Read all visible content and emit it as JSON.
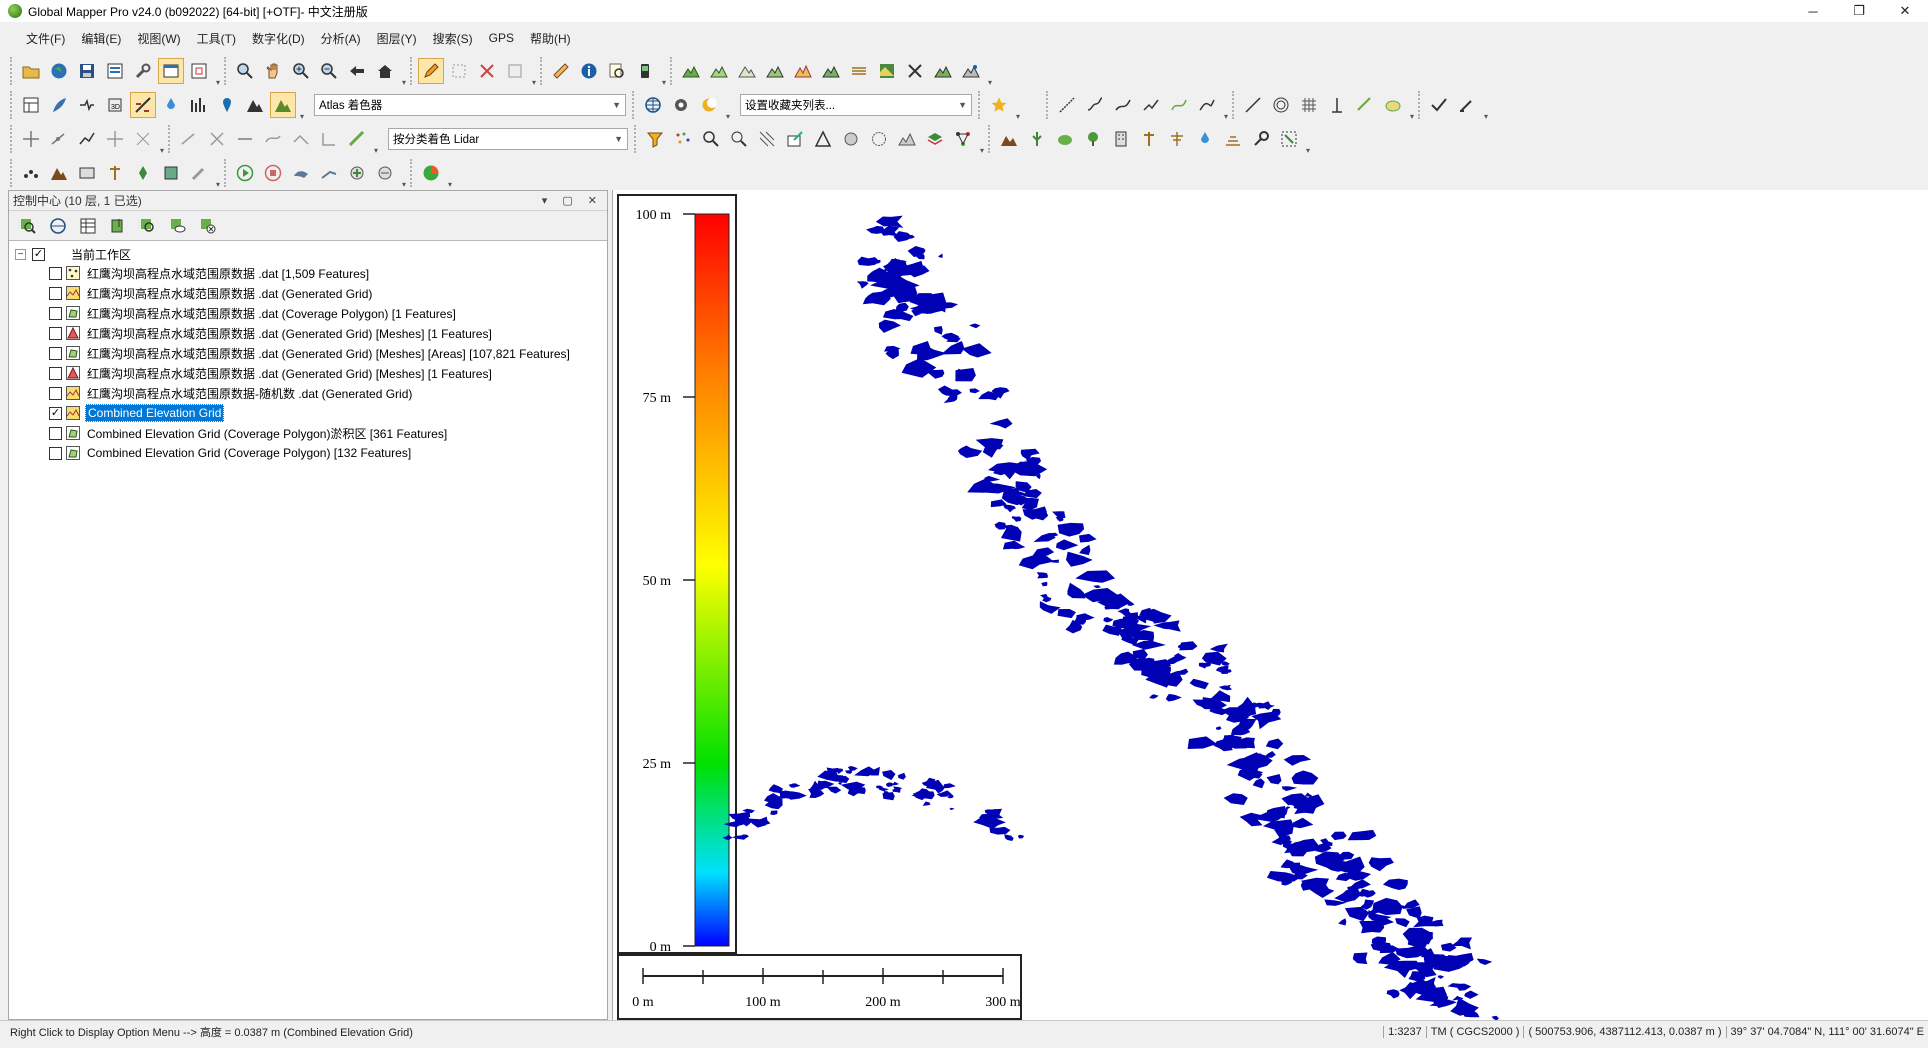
{
  "window": {
    "title": "Global Mapper Pro v24.0 (b092022) [64-bit] [+OTF]- 中文注册版",
    "minimize_glyph": "─",
    "restore_glyph": "❐",
    "close_glyph": "✕"
  },
  "menu": {
    "items": [
      "文件(F)",
      "编辑(E)",
      "视图(W)",
      "工具(T)",
      "数字化(D)",
      "分析(A)",
      "图层(Y)",
      "搜索(S)",
      "GPS",
      "帮助(H)"
    ]
  },
  "toolbar": {
    "shader_combo": "Atlas 着色器",
    "favorites_combo": "设置收藏夹列表...",
    "lidar_combo": "按分类着色 Lidar"
  },
  "control_center": {
    "title": "控制中心 (10 层, 1 已选)",
    "root_label": "当前工作区",
    "root_checked": true,
    "layers": [
      {
        "label": "红鹰沟坝高程点水域范围原数据 .dat [1,509 Features]",
        "icon": "points-icon",
        "checked": false,
        "selected": false
      },
      {
        "label": "红鹰沟坝高程点水域范围原数据 .dat (Generated Grid)",
        "icon": "grid-icon",
        "checked": false,
        "selected": false
      },
      {
        "label": "红鹰沟坝高程点水域范围原数据 .dat (Coverage Polygon) [1 Features]",
        "icon": "polygon-icon",
        "checked": false,
        "selected": false
      },
      {
        "label": "红鹰沟坝高程点水域范围原数据 .dat (Generated Grid) [Meshes] [1 Features]",
        "icon": "mesh-icon",
        "checked": false,
        "selected": false
      },
      {
        "label": "红鹰沟坝高程点水域范围原数据 .dat (Generated Grid) [Meshes] [Areas] [107,821 Features]",
        "icon": "polygon-icon",
        "checked": false,
        "selected": false
      },
      {
        "label": "红鹰沟坝高程点水域范围原数据 .dat (Generated Grid) [Meshes] [1 Features]",
        "icon": "mesh-icon",
        "checked": false,
        "selected": false
      },
      {
        "label": "红鹰沟坝高程点水域范围原数据-随机数 .dat (Generated Grid)",
        "icon": "grid-icon",
        "checked": false,
        "selected": false
      },
      {
        "label": "Combined Elevation Grid",
        "icon": "grid-icon",
        "checked": true,
        "selected": true
      },
      {
        "label": "Combined Elevation Grid (Coverage Polygon)淤积区 [361 Features]",
        "icon": "polygon-icon",
        "checked": false,
        "selected": false
      },
      {
        "label": "Combined Elevation Grid (Coverage Polygon) [132 Features]",
        "icon": "polygon-icon",
        "checked": false,
        "selected": false
      }
    ]
  },
  "map": {
    "legend": {
      "ticks": [
        "100 m",
        "75 m",
        "50 m",
        "25 m",
        "0 m"
      ],
      "colors": [
        "#ff0000",
        "#ff8000",
        "#ffff00",
        "#00e000",
        "#00e0ff",
        "#0000ff"
      ]
    },
    "scale_bar": {
      "labels": [
        "0 m",
        "100 m",
        "200 m",
        "300 m"
      ]
    },
    "feature_color": "#0000b4"
  },
  "status": {
    "hint": "Right Click to Display Option Menu --> 高度 = 0.0387 m (Combined Elevation Grid)",
    "scale": "1:3237",
    "projection": "TM ( CGCS2000 )",
    "coords": "( 500753.906, 4387112.413, 0.0387 m )",
    "latlon": "39° 37' 04.7084\" N, 111° 00' 31.6074\" E"
  }
}
